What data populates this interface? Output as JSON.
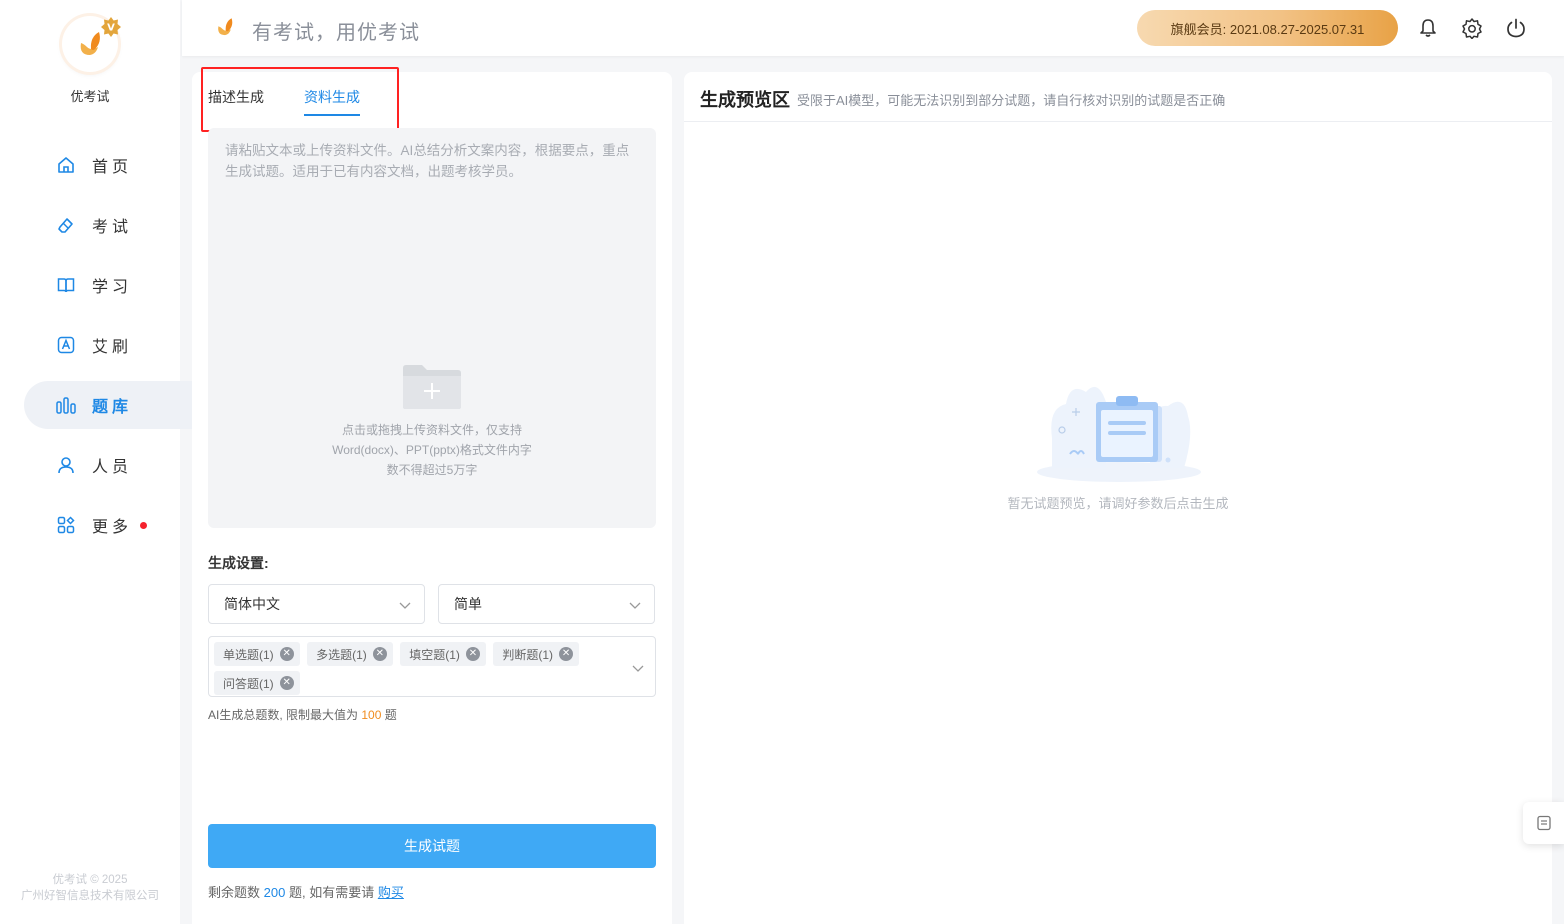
{
  "sidebar": {
    "app_name": "优考试",
    "items": [
      {
        "label": "首页",
        "icon": "home-icon"
      },
      {
        "label": "考试",
        "icon": "eraser-icon"
      },
      {
        "label": "学习",
        "icon": "book-icon"
      },
      {
        "label": "艾刷",
        "icon": "letter-a-icon"
      },
      {
        "label": "题库",
        "icon": "bar-chart-icon"
      },
      {
        "label": "人员",
        "icon": "user-icon"
      },
      {
        "label": "更多",
        "icon": "grid-icon"
      }
    ],
    "active_item": "题库",
    "copyright_line1": "优考试 © 2025",
    "copyright_line2": "广州好智信息技术有限公司"
  },
  "header": {
    "slogan": "有考试，用优考试",
    "membership": "旗舰会员: 2021.08.27-2025.07.31",
    "icons": [
      "bell-icon",
      "gear-icon",
      "power-icon"
    ]
  },
  "left_panel": {
    "tabs": [
      {
        "label": "描述生成",
        "active": false
      },
      {
        "label": "资料生成",
        "active": true
      }
    ],
    "dropzone": {
      "placeholder": "请粘贴文本或上传资料文件。AI总结分析文案内容，根据要点，重点生成试题。适用于已有内容文档，出题考核学员。",
      "hint_line1": "点击或拖拽上传资料文件，仅支持",
      "hint_line2": "Word(docx)、PPT(pptx)格式文件内字",
      "hint_line3": "数不得超过5万字"
    },
    "settings_title": "生成设置:",
    "language_select": "简体中文",
    "difficulty_select": "简单",
    "question_types": [
      "单选题(1)",
      "多选题(1)",
      "填空题(1)",
      "判断题(1)",
      "问答题(1)"
    ],
    "limit_prefix": "AI生成总题数, 限制最大值为",
    "limit_value": "100",
    "limit_suffix": "题",
    "generate_button": "生成试题",
    "remain_prefix": "剩余题数",
    "remain_value": "200",
    "remain_middle": "题, 如有需要请",
    "buy_link": "购买"
  },
  "right_panel": {
    "title": "生成预览区",
    "subtitle": "受限于AI模型，可能无法识别到部分试题，请自行核对识别的试题是否正确",
    "empty_text": "暂无试题预览，请调好参数后点击生成"
  },
  "colors": {
    "accent": "#1e88e5",
    "button": "#3fa9f5",
    "member_gradient_end": "#e8a246",
    "highlight_box": "#ff2222"
  }
}
